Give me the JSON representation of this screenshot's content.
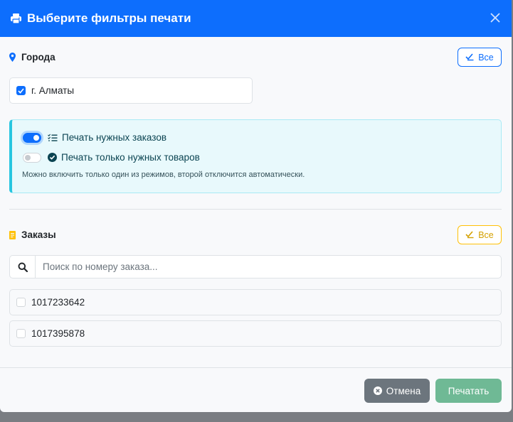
{
  "modal": {
    "title": "Выберите фильтры печати"
  },
  "cities": {
    "heading": "Города",
    "all_label": "Все",
    "items": [
      {
        "label": "г. Алматы",
        "checked": true
      }
    ]
  },
  "mode": {
    "print_orders_label": "Печать нужных заказов",
    "print_orders_on": true,
    "print_goods_label": "Печать только нужных товаров",
    "print_goods_on": false,
    "note": "Можно включить только один из режимов, второй отключится автоматически."
  },
  "orders": {
    "heading": "Заказы",
    "all_label": "Все",
    "search_placeholder": "Поиск по номеру заказа...",
    "search_value": "",
    "items": [
      {
        "number": "1017233642",
        "checked": false
      },
      {
        "number": "1017395878",
        "checked": false
      }
    ]
  },
  "footer": {
    "cancel_label": "Отмена",
    "print_label": "Печатать"
  },
  "colors": {
    "primary": "#0d6efd",
    "warning": "#ffc107",
    "info": "#27c6e0",
    "secondary": "#6c757d",
    "success_muted": "#6fb995"
  }
}
